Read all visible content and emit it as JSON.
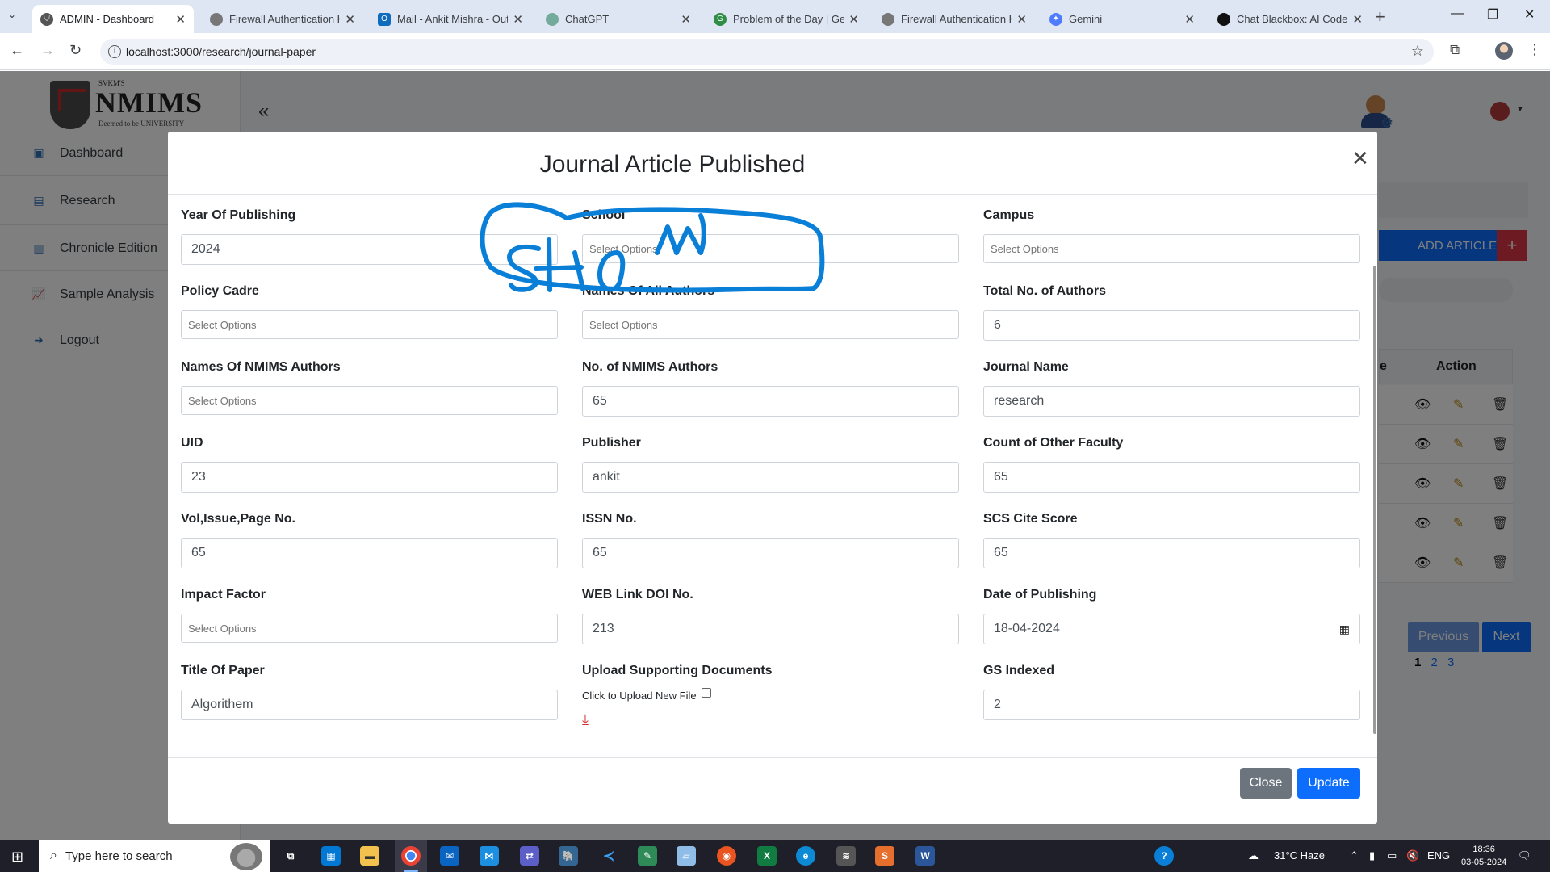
{
  "browser": {
    "tabs": [
      {
        "title": "ADMIN - Dashboard",
        "active": true
      },
      {
        "title": "Firewall Authentication Ke"
      },
      {
        "title": "Mail - Ankit Mishra - Outl"
      },
      {
        "title": "ChatGPT"
      },
      {
        "title": "Problem of the Day | Geek"
      },
      {
        "title": "Firewall Authentication Ke"
      },
      {
        "title": "Gemini"
      },
      {
        "title": "Chat Blackbox: AI Code G"
      }
    ],
    "url": "localhost:3000/research/journal-paper"
  },
  "sidebar": {
    "logo": {
      "top": "SVKM'S",
      "name": "NMIMS",
      "tagline": "Deemed to be UNIVERSITY"
    },
    "items": [
      {
        "label": "Dashboard",
        "icon": "dashboard-icon"
      },
      {
        "label": "Research",
        "icon": "research-icon"
      },
      {
        "label": "Chronicle Edition",
        "icon": "chronicle-icon"
      },
      {
        "label": "Sample Analysis",
        "icon": "chart-icon"
      },
      {
        "label": "Logout",
        "icon": "logout-icon"
      }
    ]
  },
  "background": {
    "add_article": "ADD ARTICLE",
    "table_headers": [
      "e",
      "Action"
    ],
    "pager": {
      "previous": "Previous",
      "next": "Next",
      "pages": [
        "1",
        "2",
        "3"
      ]
    }
  },
  "modal": {
    "title": "Journal Article Published",
    "fields": {
      "year": {
        "label": "Year Of Publishing",
        "value": "2024"
      },
      "school": {
        "label": "School",
        "placeholder": "Select Options"
      },
      "campus": {
        "label": "Campus",
        "placeholder": "Select Options"
      },
      "policy_cadre": {
        "label": "Policy Cadre",
        "placeholder": "Select Options"
      },
      "all_authors": {
        "label": "Names Of All Authors",
        "placeholder": "Select Options"
      },
      "total_authors": {
        "label": "Total No. of Authors",
        "value": "6"
      },
      "nmims_authors_names": {
        "label": "Names Of NMIMS Authors",
        "placeholder": "Select Options"
      },
      "nmims_authors_count": {
        "label": "No. of NMIMS Authors",
        "value": "65"
      },
      "journal_name": {
        "label": "Journal Name",
        "value": "research"
      },
      "uid": {
        "label": "UID",
        "value": "23"
      },
      "publisher": {
        "label": "Publisher",
        "value": "ankit"
      },
      "other_faculty": {
        "label": "Count of Other Faculty",
        "value": "65"
      },
      "vol_issue": {
        "label": "Vol,Issue,Page No.",
        "value": "65"
      },
      "issn": {
        "label": "ISSN No.",
        "value": "65"
      },
      "scs_cite": {
        "label": "SCS Cite Score",
        "value": "65"
      },
      "impact_factor": {
        "label": "Impact Factor",
        "placeholder": "Select Options"
      },
      "doi": {
        "label": "WEB Link DOI No.",
        "value": "213"
      },
      "date": {
        "label": "Date of Publishing",
        "value": "18-04-2024"
      },
      "title": {
        "label": "Title Of Paper",
        "value": "Algorithem"
      },
      "upload": {
        "label": "Upload Supporting Documents",
        "hint": "Click to Upload New File"
      },
      "gs_indexed": {
        "label": "GS Indexed",
        "value": "2"
      }
    },
    "footer": {
      "close": "Close",
      "update": "Update"
    },
    "annotation_text": "SHOW",
    "annotation_color": "#0a7fd8"
  },
  "taskbar": {
    "search_placeholder": "Type here to search",
    "weather": "31°C  Haze",
    "language": "ENG",
    "time": "18:36",
    "date": "03-05-2024"
  },
  "colors": {
    "primary": "#0d6efd",
    "secondary": "#6c757d",
    "danger": "#dc3545"
  }
}
